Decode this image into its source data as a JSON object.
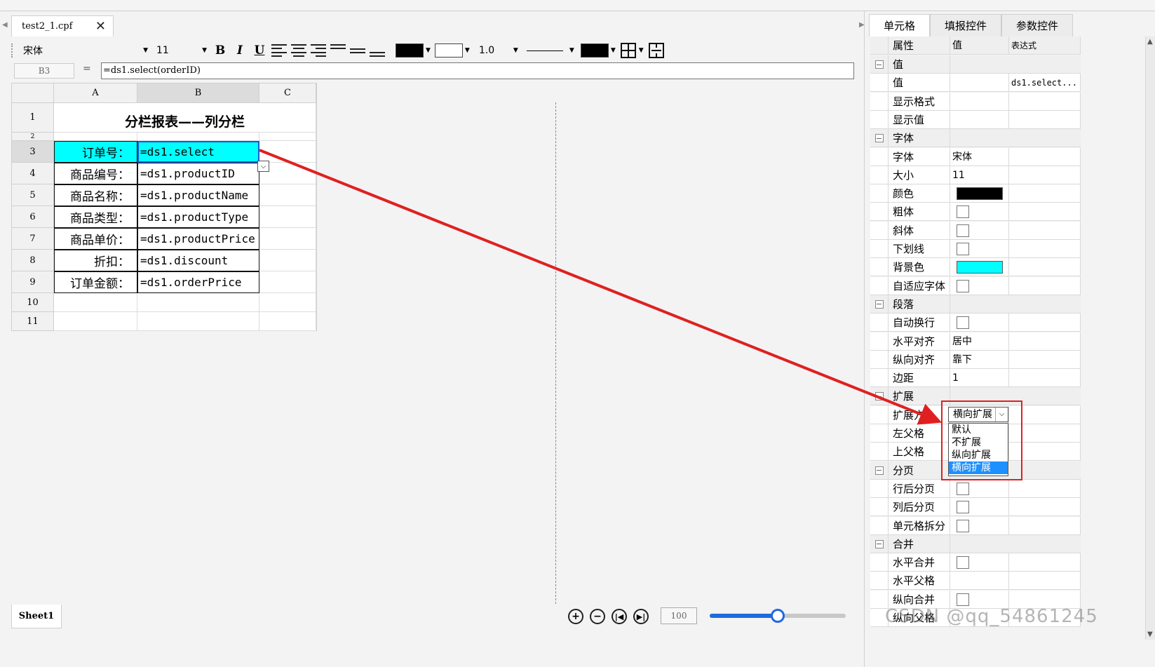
{
  "document_tab": {
    "title": "test2_1.cpf",
    "close": "✕"
  },
  "toolbar": {
    "font_family": "宋体",
    "font_size": "11",
    "bold": "B",
    "italic": "I",
    "underline": "U",
    "line_width": "1.0",
    "font_color": "#000000",
    "border_color": "#000000"
  },
  "formula_bar": {
    "cell_ref": "B3",
    "equals": "=",
    "formula": "=ds1.select(orderID)"
  },
  "sheet": {
    "columns": [
      "A",
      "B",
      "C"
    ],
    "rows": [
      "1",
      "2",
      "3",
      "4",
      "5",
      "6",
      "7",
      "8",
      "9",
      "10",
      "11"
    ],
    "title": "分栏报表——列分栏",
    "labels": [
      "订单号：",
      "商品编号：",
      "商品名称：",
      "商品类型：",
      "商品单价：",
      "折扣：",
      "订单金额："
    ],
    "values": [
      "=ds1.select",
      "=ds1.productID",
      "=ds1.productName",
      "=ds1.productType",
      "=ds1.productPrice",
      "=ds1.discount",
      "=ds1.orderPrice"
    ],
    "highlight_color": "#00ffff"
  },
  "bottom": {
    "sheet_tab": "Sheet1",
    "zoom_value": "100",
    "zoom_level": 0.5
  },
  "panel": {
    "tabs": [
      "单元格",
      "填报控件",
      "参数控件"
    ],
    "headers": [
      "属性",
      "值",
      "表达式"
    ],
    "rows": [
      {
        "label": "值",
        "group": true
      },
      {
        "label": "值",
        "value": "",
        "expr": "ds1.select..."
      },
      {
        "label": "显示格式",
        "value": ""
      },
      {
        "label": "显示值",
        "value": ""
      },
      {
        "label": "字体",
        "group": true
      },
      {
        "label": "字体",
        "value": "宋体"
      },
      {
        "label": "大小",
        "value": "11"
      },
      {
        "label": "颜色",
        "swatch": "#000000"
      },
      {
        "label": "粗体",
        "checkbox": true
      },
      {
        "label": "斜体",
        "checkbox": true
      },
      {
        "label": "下划线",
        "checkbox": true
      },
      {
        "label": "背景色",
        "swatch": "#00ffff"
      },
      {
        "label": "自适应字体",
        "checkbox": true
      },
      {
        "label": "段落",
        "group": true
      },
      {
        "label": "自动换行",
        "checkbox": true
      },
      {
        "label": "水平对齐",
        "value": "居中"
      },
      {
        "label": "纵向对齐",
        "value": "靠下"
      },
      {
        "label": "边距",
        "value": "1"
      },
      {
        "label": "扩展",
        "group": true
      },
      {
        "label": "扩展方",
        "value": ""
      },
      {
        "label": "左父格",
        "value": ""
      },
      {
        "label": "上父格",
        "value": ""
      },
      {
        "label": "分页",
        "group": true
      },
      {
        "label": "行后分页",
        "checkbox": true
      },
      {
        "label": "列后分页",
        "checkbox": true
      },
      {
        "label": "单元格拆分",
        "checkbox": true
      },
      {
        "label": "合并",
        "group": true
      },
      {
        "label": "水平合并",
        "checkbox": true
      },
      {
        "label": "水平父格",
        "value": ""
      },
      {
        "label": "纵向合并",
        "checkbox": true
      },
      {
        "label": "纵向父格",
        "value": ""
      }
    ],
    "expand_select": "横向扩展",
    "expand_options": [
      "默认",
      "不扩展",
      "纵向扩展",
      "横向扩展"
    ],
    "expand_selected_index": 3
  },
  "watermark": "CSDN @qq_54861245",
  "colors": {
    "annotation_red": "#e02020",
    "accent_blue": "#1f6ae0"
  }
}
